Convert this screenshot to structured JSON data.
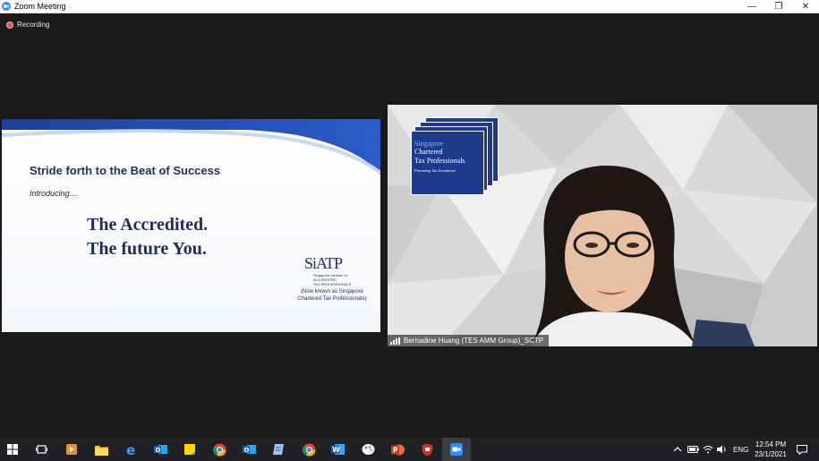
{
  "window": {
    "title": "Zoom Meeting",
    "minimize_glyph": "—",
    "restore_glyph": "❐",
    "close_glyph": "✕"
  },
  "recording": {
    "label": "Recording"
  },
  "shared_slide": {
    "heading": "Stride forth to the Beat of Success",
    "intro": "Introducing…",
    "line1": "The Accredited.",
    "line2": "The future You.",
    "logo_mark": "SiATP",
    "logo_sub1": "Singapore Institute of",
    "logo_sub2": "ACCREDITED",
    "logo_sub3": "TAX PROFESSIONALS",
    "note_line1": "(Now known as Singapore",
    "note_line2": "Chartered Tax Professionals)"
  },
  "video": {
    "banner_line1": "Singapore",
    "banner_line2": "Chartered",
    "banner_line3": "Tax Professionals",
    "banner_tagline": "Promoting Tax Excellence",
    "participant_name": "Bernadine Huang (TES AMM Group)_SCTP"
  },
  "taskbar": {
    "apps": [
      "windows-start",
      "task-view",
      "media-player",
      "file-explorer",
      "internet-explorer",
      "outlook",
      "sticky-notes",
      "chrome",
      "outlook-2",
      "notepad",
      "chrome-2",
      "word",
      "paint",
      "powerpoint",
      "security",
      "zoom"
    ],
    "tray_language": "ENG",
    "time": "12:54 PM",
    "date": "23/1/2021"
  },
  "colors": {
    "navy": "#1f2d5a",
    "sctp_blue": "#1e3a8a",
    "record_red": "#d9534f",
    "taskbar": "#202124"
  }
}
